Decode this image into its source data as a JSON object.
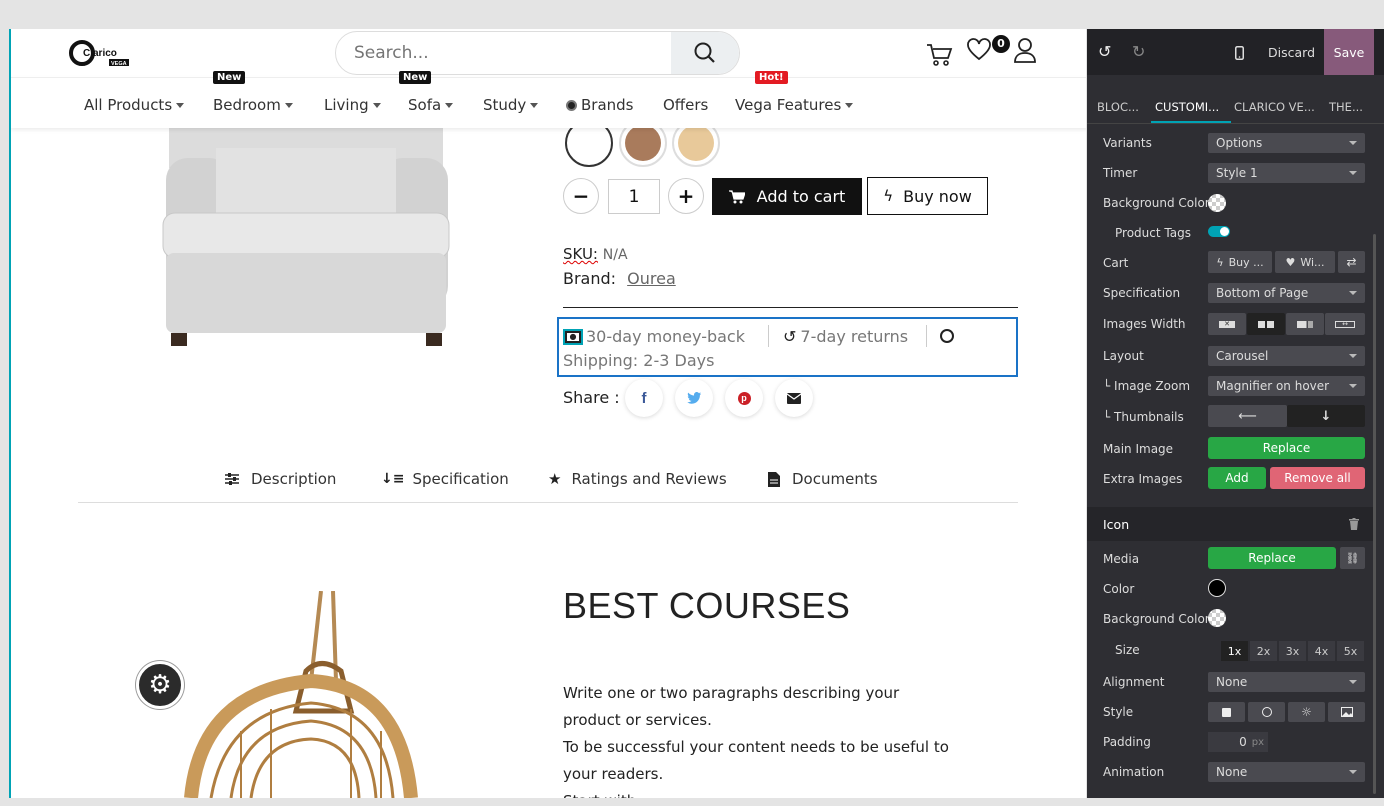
{
  "header": {
    "logo_text": "Clarico",
    "logo_sub": "VEGA",
    "search_placeholder": "Search...",
    "wishlist_count": "0"
  },
  "nav": {
    "items": [
      {
        "label": "All Products",
        "badge": ""
      },
      {
        "label": "Bedroom",
        "badge": "New"
      },
      {
        "label": "Living",
        "badge": ""
      },
      {
        "label": "Sofa",
        "badge": "New"
      },
      {
        "label": "Study",
        "badge": ""
      },
      {
        "label": "Brands",
        "badge": ""
      },
      {
        "label": "Offers",
        "badge": ""
      },
      {
        "label": "Vega Features",
        "badge": "Hot!"
      }
    ]
  },
  "product": {
    "swatch_colors": [
      "#ffffff",
      "#a97b5c",
      "#e8c99a"
    ],
    "quantity": "1",
    "add_to_cart": "Add to cart",
    "buy_now": "Buy now",
    "sku_label": "SKU:",
    "sku_value": "N/A",
    "brand_label": "Brand:",
    "brand_value": "Ourea",
    "money_back": "30-day money-back",
    "returns": "7-day returns",
    "shipping": "Shipping: 2-3 Days",
    "share_label": "Share :"
  },
  "tabs": [
    "Description",
    "Specification",
    "Ratings and Reviews",
    "Documents"
  ],
  "content": {
    "heading": "BEST COURSES",
    "para1": "Write one or two paragraphs describing your product or services.",
    "para2": "To be successful your content needs to be useful to your readers.",
    "para3": "Start with"
  },
  "panel": {
    "discard": "Discard",
    "save": "Save",
    "tabs": [
      "BLOC...",
      "CUSTOMI...",
      "CLARICO VE...",
      "THE..."
    ],
    "rows": {
      "variants_label": "Variants",
      "variants_value": "Options",
      "timer_label": "Timer",
      "timer_value": "Style 1",
      "bg_label": "Background Color",
      "tags_label": "Product Tags",
      "cart_label": "Cart",
      "cart_buy": "Buy ...",
      "cart_wish": "Wi...",
      "spec_label": "Specification",
      "spec_value": "Bottom of Page",
      "imgw_label": "Images Width",
      "layout_label": "Layout",
      "layout_value": "Carousel",
      "zoom_label": "└ Image Zoom",
      "zoom_value": "Magnifier on hover",
      "thumbs_label": "└ Thumbnails",
      "main_label": "Main Image",
      "main_btn": "Replace",
      "extra_label": "Extra Images",
      "extra_add": "Add",
      "extra_remove": "Remove all"
    },
    "icon_section": {
      "title": "Icon",
      "media_label": "Media",
      "media_btn": "Replace",
      "color_label": "Color",
      "color_value": "#000000",
      "bg_label": "Background Color",
      "size_label": "Size",
      "sizes": [
        "1x",
        "2x",
        "3x",
        "4x",
        "5x"
      ],
      "align_label": "Alignment",
      "align_value": "None",
      "style_label": "Style",
      "padding_label": "Padding",
      "padding_value": "0",
      "padding_unit": "px",
      "anim_label": "Animation",
      "anim_value": "None"
    }
  },
  "colors": {
    "accent": "#00a3b5",
    "save_bg": "#875a7b",
    "green": "#28a745",
    "red": "#e06575"
  }
}
